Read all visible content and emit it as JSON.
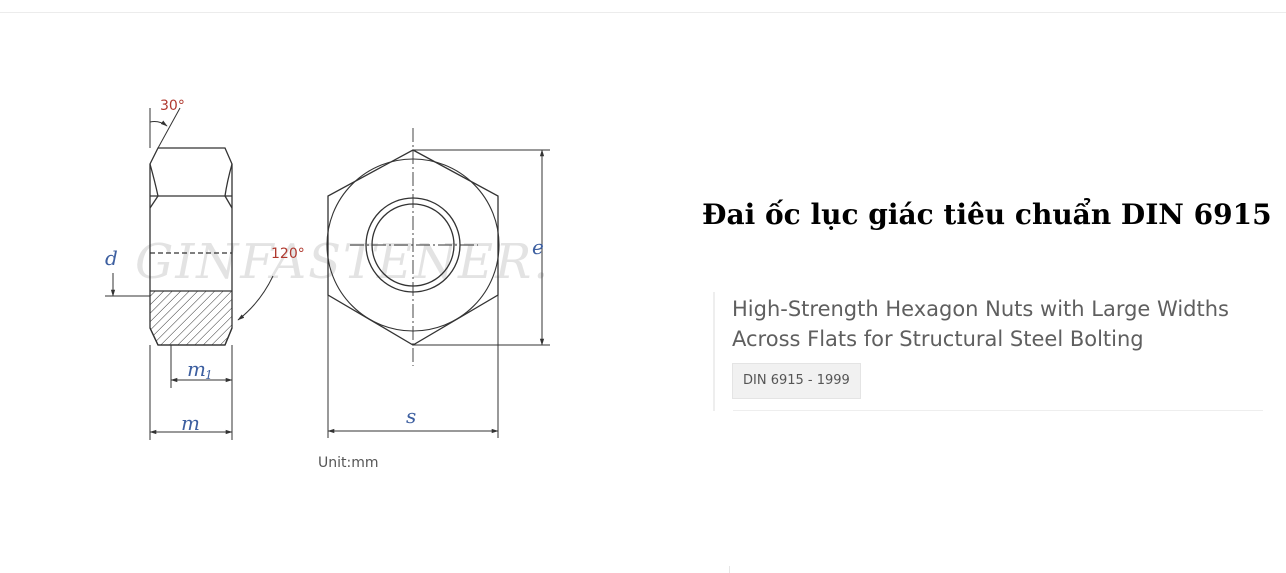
{
  "drawing": {
    "watermark": "GINFASTENER.",
    "labels": {
      "chamfer_angle": "30°",
      "face_angle": "120°",
      "d": "d",
      "e": "e",
      "s": "s",
      "m": "m",
      "m1": "m",
      "m1_sub": "1"
    },
    "unit": "Unit:mm"
  },
  "title": "Đai ốc lục giác tiêu chuẩn DIN 6915",
  "card": {
    "subtitle": "High-Strength Hexagon Nuts with Large Widths Across Flats for Structural Steel Bolting",
    "standard": "DIN 6915 - 1999"
  },
  "colors": {
    "angle_label": "#b0392f",
    "dimension_label": "#3d5fa0",
    "line": "#333333"
  }
}
